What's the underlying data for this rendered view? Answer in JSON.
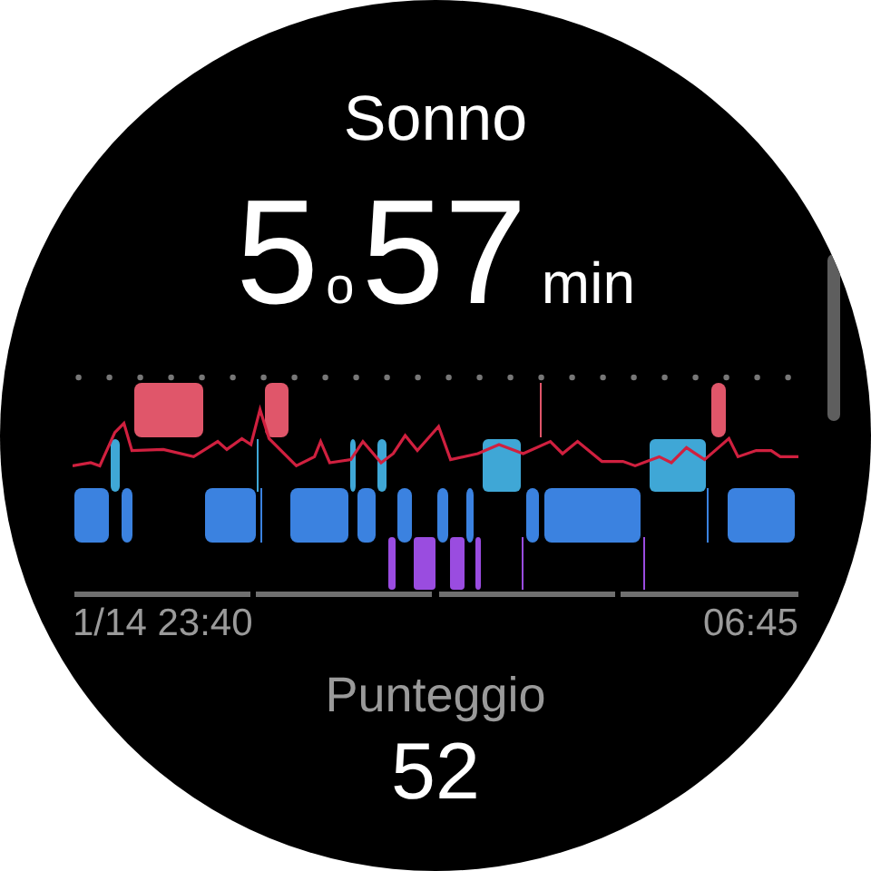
{
  "title": "Sonno",
  "duration": {
    "hours": "5",
    "hours_unit": "o",
    "minutes": "57",
    "minutes_unit": "min"
  },
  "chart": {
    "start_label": "1/14 23:40",
    "end_label": "06:45"
  },
  "score": {
    "label": "Punteggio",
    "value": "52"
  }
}
